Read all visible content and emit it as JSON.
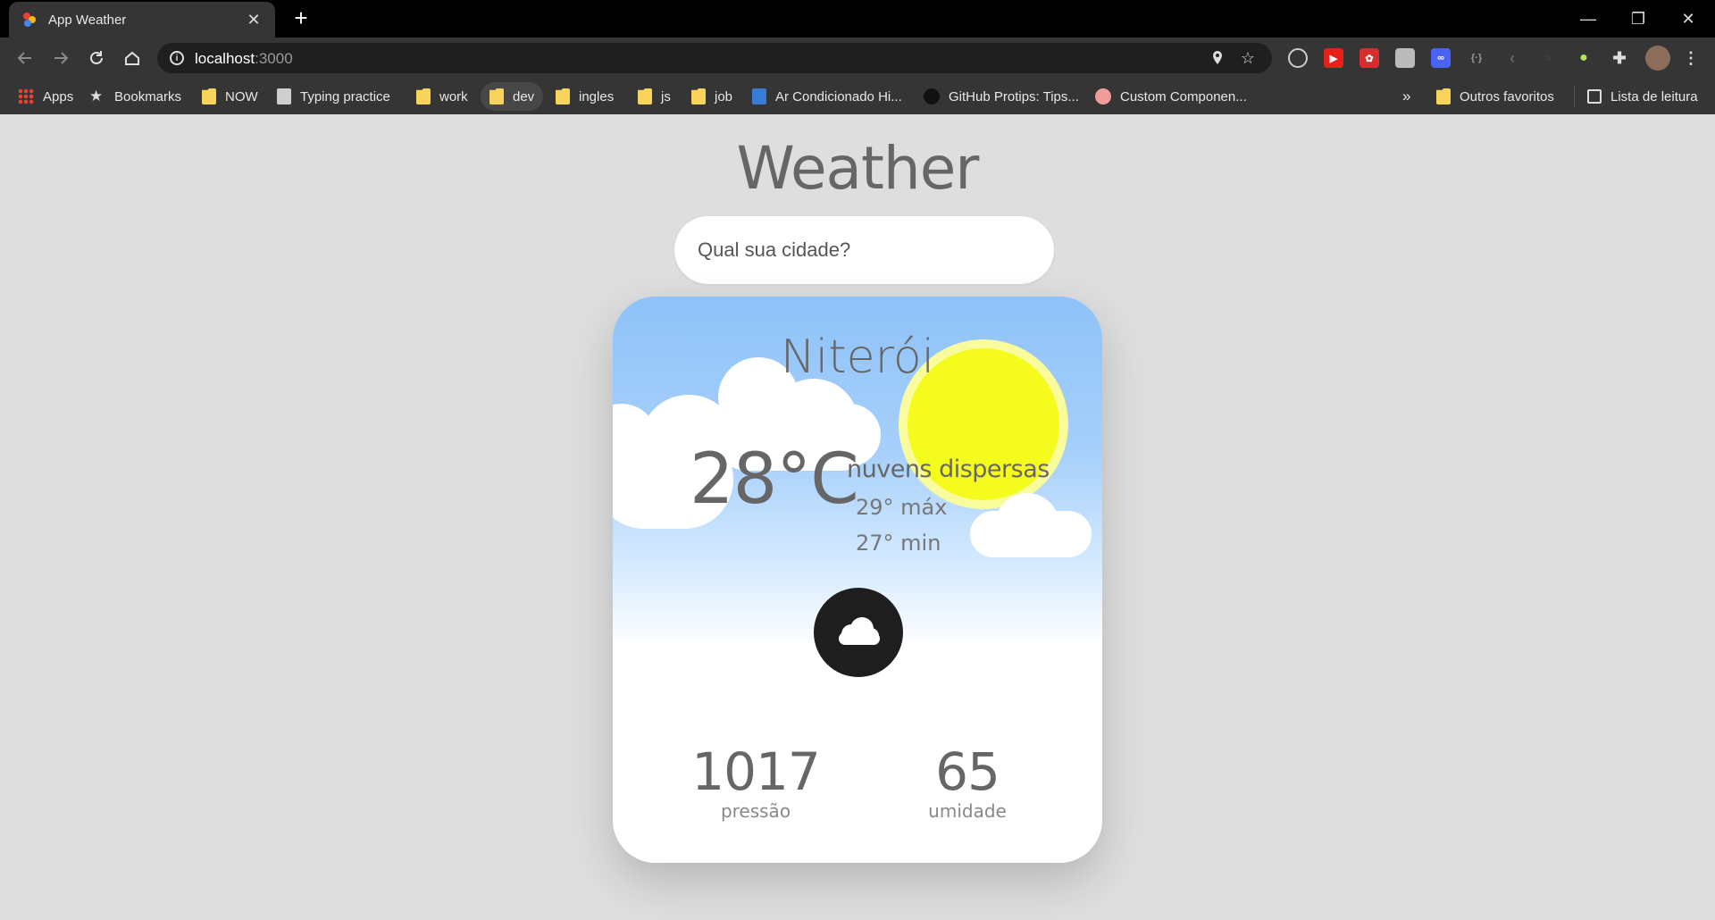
{
  "browser": {
    "tab_title": "App Weather",
    "tab_close": "✕",
    "new_tab": "+",
    "url_host": "localhost",
    "url_port": ":3000",
    "window": {
      "minimize": "—",
      "restore": "❐",
      "close": "✕"
    },
    "bookmarks": [
      {
        "label": "Apps",
        "icon": "apps-grid-icon"
      },
      {
        "label": "Bookmarks",
        "icon": "star-icon"
      },
      {
        "label": "NOW",
        "icon": "folder-icon"
      },
      {
        "label": "Typing practice",
        "icon": "page-icon"
      },
      {
        "label": "work",
        "icon": "folder-icon"
      },
      {
        "label": "dev",
        "icon": "folder-icon"
      },
      {
        "label": "ingles",
        "icon": "folder-icon"
      },
      {
        "label": "js",
        "icon": "folder-icon"
      },
      {
        "label": "job",
        "icon": "folder-icon"
      },
      {
        "label": "Ar Condicionado Hi...",
        "icon": "site-icon"
      },
      {
        "label": "GitHub Protips: Tips...",
        "icon": "github-icon"
      },
      {
        "label": "Custom Componen...",
        "icon": "site-icon"
      }
    ],
    "bookmarks_overflow": "»",
    "other_bookmarks": "Outros favoritos",
    "reading_list": "Lista de leitura",
    "folder_color": "#f7d35c"
  },
  "page": {
    "title": "Weather",
    "search_placeholder": "Qual sua cidade?"
  },
  "weather": {
    "city": "Niterói",
    "temperature": "28°C",
    "description": "nuvens dispersas",
    "max": "29° máx",
    "min": "27° min",
    "icon": "cloud-icon",
    "pressure_value": "1017",
    "pressure_label": "pressão",
    "humidity_value": "65",
    "humidity_label": "umidade",
    "sun_color": "#f6fb1e",
    "sky_color": "#8ec2f8"
  }
}
